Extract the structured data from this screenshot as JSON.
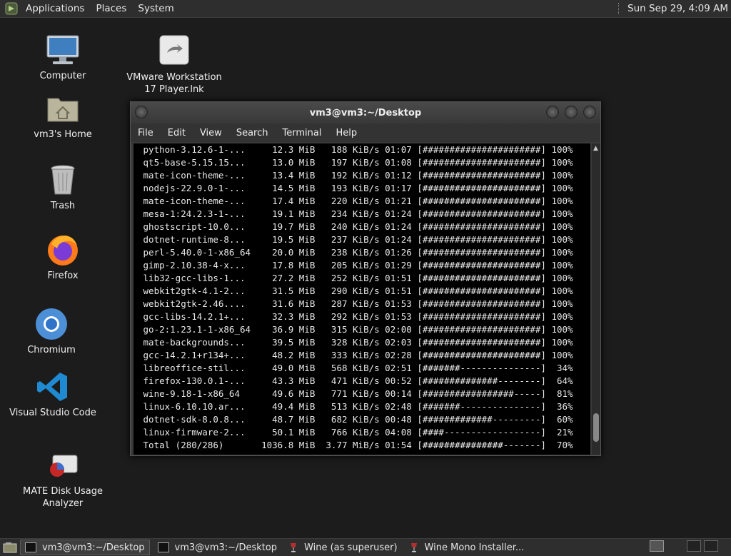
{
  "top_panel": {
    "menu": [
      "Applications",
      "Places",
      "System"
    ],
    "clock": "Sun Sep 29,  4:09 AM"
  },
  "desktop_icons": {
    "computer": "Computer",
    "vmware": [
      "VMware Workstation",
      "17 Player.lnk"
    ],
    "home": "vm3's Home",
    "trash": "Trash",
    "firefox": "Firefox",
    "chromium": "Chromium",
    "vscode": "Visual Studio Code",
    "disk_usage": [
      "MATE Disk Usage",
      "Analyzer"
    ]
  },
  "terminal": {
    "title": "vm3@vm3:~/Desktop",
    "menu": [
      "File",
      "Edit",
      "View",
      "Search",
      "Terminal",
      "Help"
    ],
    "lines": [
      " python-3.12.6-1-...     12.3 MiB   188 KiB/s 01:07 [######################] 100%",
      " qt5-base-5.15.15...     13.0 MiB   197 KiB/s 01:08 [######################] 100%",
      " mate-icon-theme-...     13.4 MiB   192 KiB/s 01:12 [######################] 100%",
      " nodejs-22.9.0-1-...     14.5 MiB   193 KiB/s 01:17 [######################] 100%",
      " mate-icon-theme-...     17.4 MiB   220 KiB/s 01:21 [######################] 100%",
      " mesa-1:24.2.3-1-...     19.1 MiB   234 KiB/s 01:24 [######################] 100%",
      " ghostscript-10.0...     19.7 MiB   240 KiB/s 01:24 [######################] 100%",
      " dotnet-runtime-8...     19.5 MiB   237 KiB/s 01:24 [######################] 100%",
      " perl-5.40.0-1-x86_64    20.0 MiB   238 KiB/s 01:26 [######################] 100%",
      " gimp-2.10.38-4-x...     17.8 MiB   205 KiB/s 01:29 [######################] 100%",
      " lib32-gcc-libs-1...     27.2 MiB   252 KiB/s 01:51 [######################] 100%",
      " webkit2gtk-4.1-2...     31.5 MiB   290 KiB/s 01:51 [######################] 100%",
      " webkit2gtk-2.46....     31.6 MiB   287 KiB/s 01:53 [######################] 100%",
      " gcc-libs-14.2.1+...     32.3 MiB   292 KiB/s 01:53 [######################] 100%",
      " go-2:1.23.1-1-x86_64    36.9 MiB   315 KiB/s 02:00 [######################] 100%",
      " mate-backgrounds...     39.5 MiB   328 KiB/s 02:03 [######################] 100%",
      " gcc-14.2.1+r134+...     48.2 MiB   333 KiB/s 02:28 [######################] 100%",
      " libreoffice-stil...     49.0 MiB   568 KiB/s 02:51 [#######---------------]  34%",
      " firefox-130.0.1-...     43.3 MiB   471 KiB/s 00:52 [##############--------]  64%",
      " wine-9.18-1-x86_64      49.6 MiB   771 KiB/s 00:14 [#################-----]  81%",
      " linux-6.10.10.ar...     49.4 MiB   513 KiB/s 02:48 [#######---------------]  36%",
      " dotnet-sdk-8.0.8...     48.7 MiB   682 KiB/s 00:48 [#############---------]  60%",
      " linux-firmware-2...     50.1 MiB   766 KiB/s 04:08 [####------------------]  21%",
      " Total (280/286)       1036.8 MiB  3.77 MiB/s 01:54 [###############-------]  70%"
    ]
  },
  "taskbar": [
    {
      "label": "vm3@vm3:~/Desktop",
      "icon": "terminal-icon",
      "active": true
    },
    {
      "label": "vm3@vm3:~/Desktop",
      "icon": "terminal-icon",
      "active": false
    },
    {
      "label": "Wine (as superuser)",
      "icon": "wine-icon",
      "active": false
    },
    {
      "label": "Wine Mono Installer...",
      "icon": "wine-icon",
      "active": false
    }
  ]
}
